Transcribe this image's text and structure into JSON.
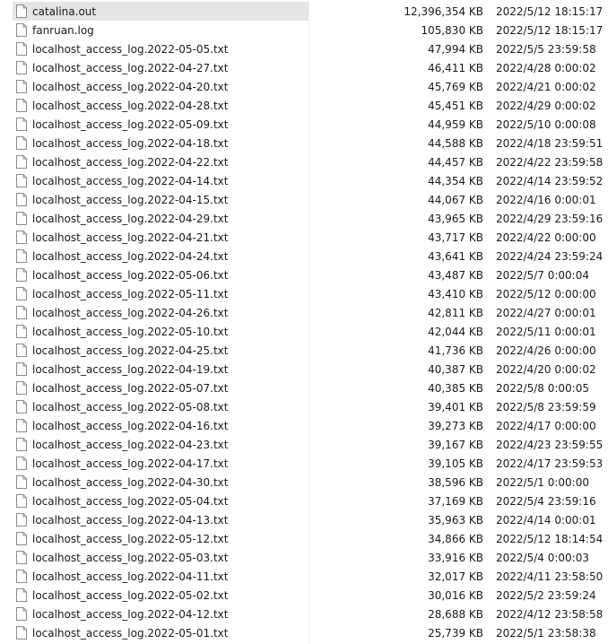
{
  "files": [
    {
      "name": "catalina.out",
      "size": "12,396,354 KB",
      "modified": "2022/5/12 18:15:17",
      "selected": true
    },
    {
      "name": "fanruan.log",
      "size": "105,830 KB",
      "modified": "2022/5/12 18:15:17"
    },
    {
      "name": "localhost_access_log.2022-05-05.txt",
      "size": "47,994 KB",
      "modified": "2022/5/5 23:59:58"
    },
    {
      "name": "localhost_access_log.2022-04-27.txt",
      "size": "46,411 KB",
      "modified": "2022/4/28 0:00:02"
    },
    {
      "name": "localhost_access_log.2022-04-20.txt",
      "size": "45,769 KB",
      "modified": "2022/4/21 0:00:02"
    },
    {
      "name": "localhost_access_log.2022-04-28.txt",
      "size": "45,451 KB",
      "modified": "2022/4/29 0:00:02"
    },
    {
      "name": "localhost_access_log.2022-05-09.txt",
      "size": "44,959 KB",
      "modified": "2022/5/10 0:00:08"
    },
    {
      "name": "localhost_access_log.2022-04-18.txt",
      "size": "44,588 KB",
      "modified": "2022/4/18 23:59:51"
    },
    {
      "name": "localhost_access_log.2022-04-22.txt",
      "size": "44,457 KB",
      "modified": "2022/4/22 23:59:58"
    },
    {
      "name": "localhost_access_log.2022-04-14.txt",
      "size": "44,354 KB",
      "modified": "2022/4/14 23:59:52"
    },
    {
      "name": "localhost_access_log.2022-04-15.txt",
      "size": "44,067 KB",
      "modified": "2022/4/16 0:00:01"
    },
    {
      "name": "localhost_access_log.2022-04-29.txt",
      "size": "43,965 KB",
      "modified": "2022/4/29 23:59:16"
    },
    {
      "name": "localhost_access_log.2022-04-21.txt",
      "size": "43,717 KB",
      "modified": "2022/4/22 0:00:00"
    },
    {
      "name": "localhost_access_log.2022-04-24.txt",
      "size": "43,641 KB",
      "modified": "2022/4/24 23:59:24"
    },
    {
      "name": "localhost_access_log.2022-05-06.txt",
      "size": "43,487 KB",
      "modified": "2022/5/7 0:00:04"
    },
    {
      "name": "localhost_access_log.2022-05-11.txt",
      "size": "43,410 KB",
      "modified": "2022/5/12 0:00:00"
    },
    {
      "name": "localhost_access_log.2022-04-26.txt",
      "size": "42,811 KB",
      "modified": "2022/4/27 0:00:01"
    },
    {
      "name": "localhost_access_log.2022-05-10.txt",
      "size": "42,044 KB",
      "modified": "2022/5/11 0:00:01"
    },
    {
      "name": "localhost_access_log.2022-04-25.txt",
      "size": "41,736 KB",
      "modified": "2022/4/26 0:00:00"
    },
    {
      "name": "localhost_access_log.2022-04-19.txt",
      "size": "40,387 KB",
      "modified": "2022/4/20 0:00:02"
    },
    {
      "name": "localhost_access_log.2022-05-07.txt",
      "size": "40,385 KB",
      "modified": "2022/5/8 0:00:05"
    },
    {
      "name": "localhost_access_log.2022-05-08.txt",
      "size": "39,401 KB",
      "modified": "2022/5/8 23:59:59"
    },
    {
      "name": "localhost_access_log.2022-04-16.txt",
      "size": "39,273 KB",
      "modified": "2022/4/17 0:00:00"
    },
    {
      "name": "localhost_access_log.2022-04-23.txt",
      "size": "39,167 KB",
      "modified": "2022/4/23 23:59:55"
    },
    {
      "name": "localhost_access_log.2022-04-17.txt",
      "size": "39,105 KB",
      "modified": "2022/4/17 23:59:53"
    },
    {
      "name": "localhost_access_log.2022-04-30.txt",
      "size": "38,596 KB",
      "modified": "2022/5/1 0:00:00"
    },
    {
      "name": "localhost_access_log.2022-05-04.txt",
      "size": "37,169 KB",
      "modified": "2022/5/4 23:59:16"
    },
    {
      "name": "localhost_access_log.2022-04-13.txt",
      "size": "35,963 KB",
      "modified": "2022/4/14 0:00:01"
    },
    {
      "name": "localhost_access_log.2022-05-12.txt",
      "size": "34,866 KB",
      "modified": "2022/5/12 18:14:54"
    },
    {
      "name": "localhost_access_log.2022-05-03.txt",
      "size": "33,916 KB",
      "modified": "2022/5/4 0:00:03"
    },
    {
      "name": "localhost_access_log.2022-04-11.txt",
      "size": "32,017 KB",
      "modified": "2022/4/11 23:58:50"
    },
    {
      "name": "localhost_access_log.2022-05-02.txt",
      "size": "30,016 KB",
      "modified": "2022/5/2 23:59:24"
    },
    {
      "name": "localhost_access_log.2022-04-12.txt",
      "size": "28,688 KB",
      "modified": "2022/4/12 23:58:58"
    },
    {
      "name": "localhost_access_log.2022-05-01.txt",
      "size": "25,739 KB",
      "modified": "2022/5/1 23:58:38"
    }
  ],
  "icon": "file-icon"
}
